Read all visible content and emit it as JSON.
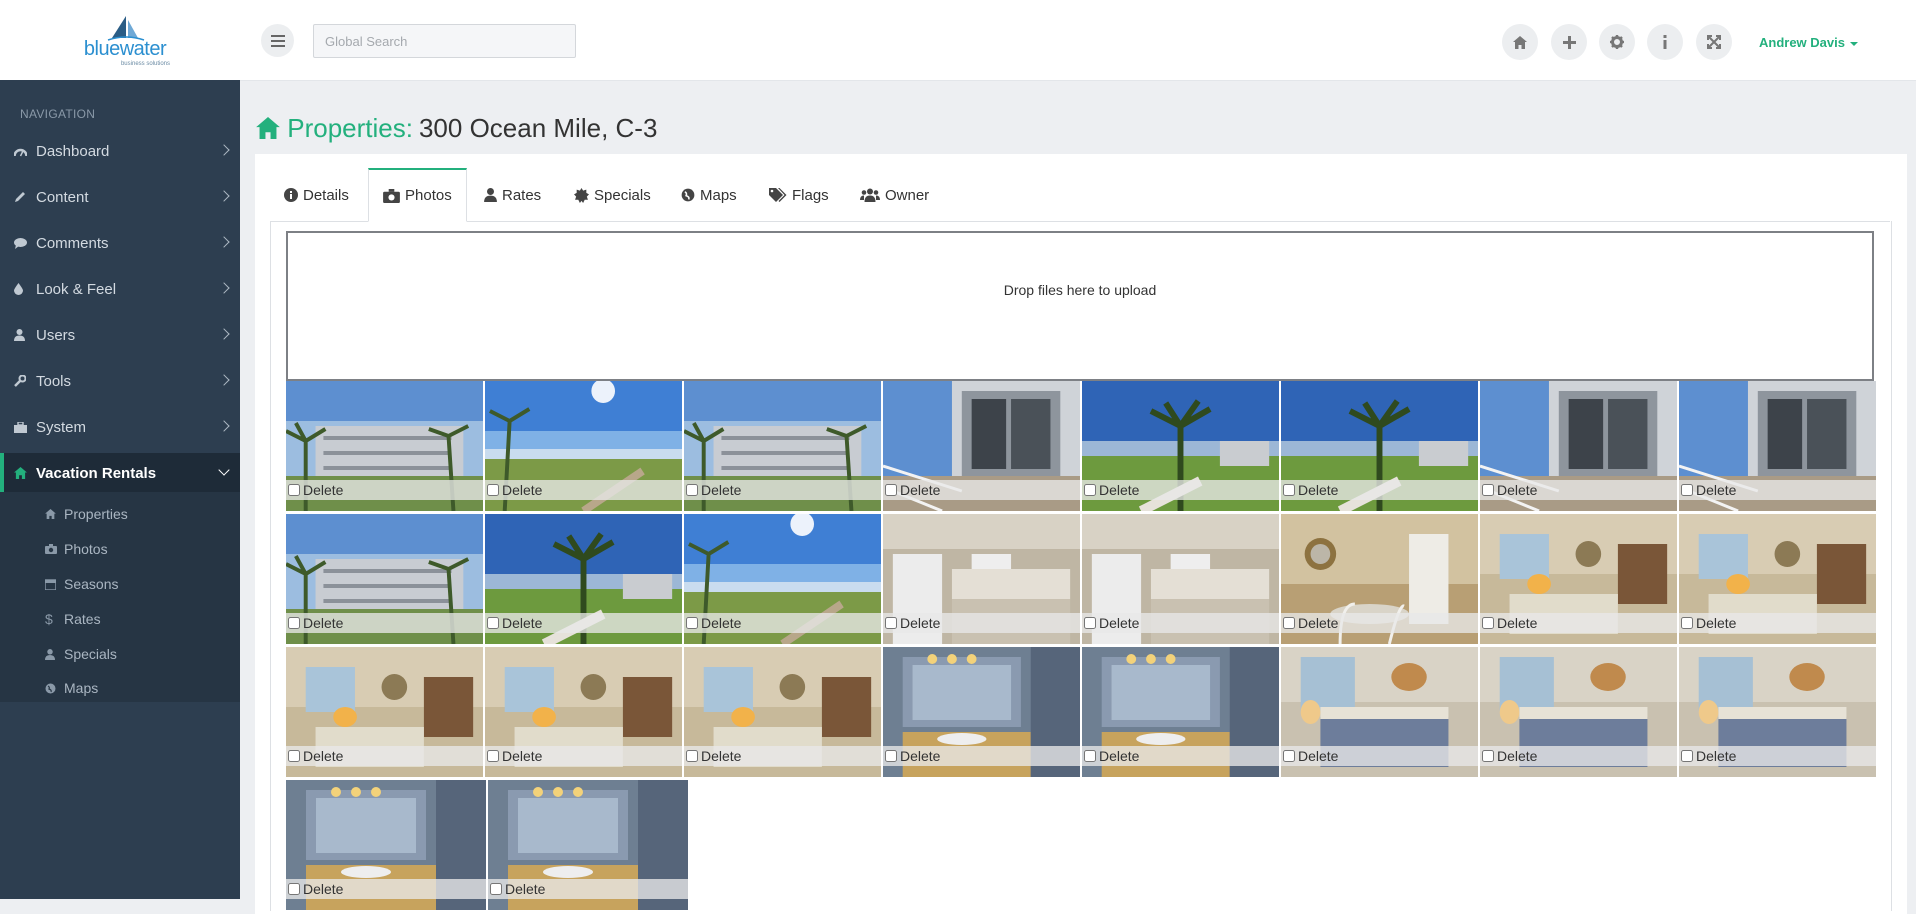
{
  "brand": {
    "word": "bluewater",
    "sub": "business solutions"
  },
  "topbar": {
    "search_placeholder": "Global Search",
    "icons": [
      "home-icon",
      "plus-icon",
      "gear-icon",
      "info-icon",
      "expand-icon"
    ],
    "user_name": "Andrew Davis"
  },
  "sidebar": {
    "title": "Navigation",
    "items": [
      {
        "label": "Dashboard",
        "icon": "dashboard-icon"
      },
      {
        "label": "Content",
        "icon": "pencil-icon"
      },
      {
        "label": "Comments",
        "icon": "comment-icon"
      },
      {
        "label": "Look & Feel",
        "icon": "tint-icon"
      },
      {
        "label": "Users",
        "icon": "user-icon"
      },
      {
        "label": "Tools",
        "icon": "wrench-icon"
      },
      {
        "label": "System",
        "icon": "briefcase-icon"
      },
      {
        "label": "Vacation Rentals",
        "icon": "home-icon",
        "active": true
      }
    ],
    "subitems": [
      {
        "label": "Properties",
        "icon": "home-icon"
      },
      {
        "label": "Photos",
        "icon": "camera-icon"
      },
      {
        "label": "Seasons",
        "icon": "calendar-icon"
      },
      {
        "label": "Rates",
        "icon": "dollar-icon"
      },
      {
        "label": "Specials",
        "icon": "user-icon"
      },
      {
        "label": "Maps",
        "icon": "globe-icon"
      }
    ]
  },
  "page": {
    "title_prefix": "Properties:",
    "title_name": "300 Ocean Mile, C-3"
  },
  "tabs": [
    {
      "label": "Details",
      "icon": "info-circle-icon"
    },
    {
      "label": "Photos",
      "icon": "camera-icon",
      "active": true
    },
    {
      "label": "Rates",
      "icon": "user-icon"
    },
    {
      "label": "Specials",
      "icon": "certificate-icon"
    },
    {
      "label": "Maps",
      "icon": "globe-icon"
    },
    {
      "label": "Flags",
      "icon": "tags-icon"
    },
    {
      "label": "Owner",
      "icon": "users-icon"
    }
  ],
  "dropzone": {
    "text": "Drop files here to upload"
  },
  "photos": {
    "delete_label": "Delete",
    "items": [
      "exterior",
      "beach",
      "exterior",
      "balcony",
      "palms",
      "palms",
      "balcony",
      "balcony",
      "exterior",
      "palms",
      "beach",
      "kitchen",
      "kitchen",
      "dining",
      "living",
      "living",
      "living",
      "living",
      "living",
      "bath",
      "bath",
      "bedroom",
      "bedroom",
      "bedroom",
      "bath",
      "bath"
    ]
  },
  "colors": {
    "accent": "#23b07d",
    "sidebar": "#2d3e50",
    "sidebar_dark": "#263544"
  }
}
